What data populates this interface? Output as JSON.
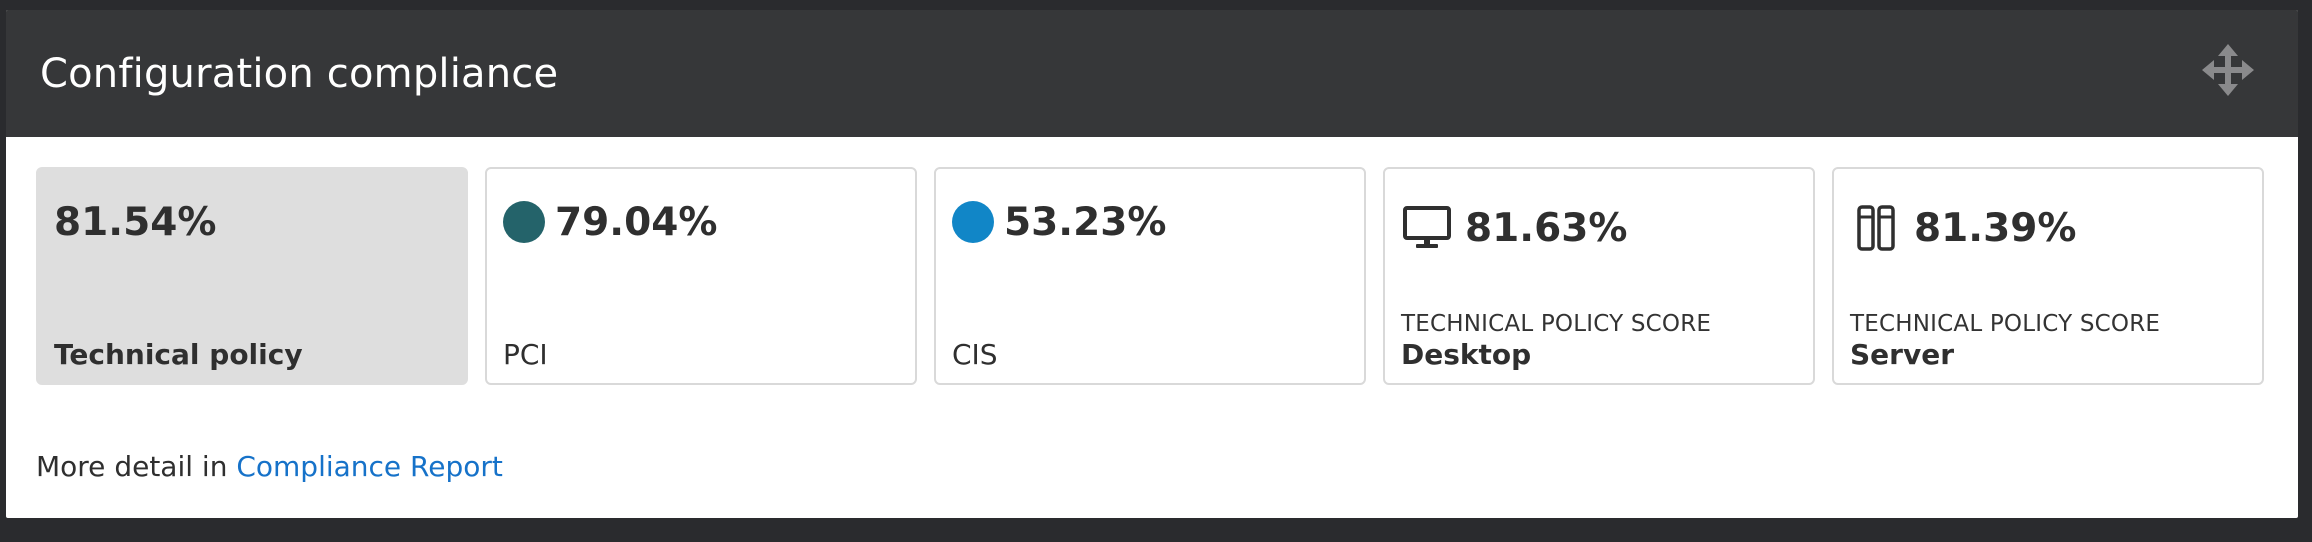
{
  "widget": {
    "title": "Configuration compliance",
    "move_icon": "move-arrows-icon"
  },
  "cards": [
    {
      "value": "81.54%",
      "label": "Technical policy",
      "selected": true
    },
    {
      "value": "79.04%",
      "label": "PCI",
      "dot_color": "#24636a"
    },
    {
      "value": "53.23%",
      "label": "CIS",
      "dot_color": "#1186c7"
    },
    {
      "value": "81.63%",
      "sub_label": "TECHNICAL POLICY SCORE",
      "label": "Desktop",
      "icon": "desktop-icon"
    },
    {
      "value": "81.39%",
      "sub_label": "TECHNICAL POLICY SCORE",
      "label": "Server",
      "icon": "server-icon"
    }
  ],
  "footer": {
    "text": "More detail in",
    "link_text": "Compliance Report"
  },
  "colors": {
    "header_bg": "#363739",
    "link": "#1672c9",
    "selected_card_bg": "#dedede"
  }
}
